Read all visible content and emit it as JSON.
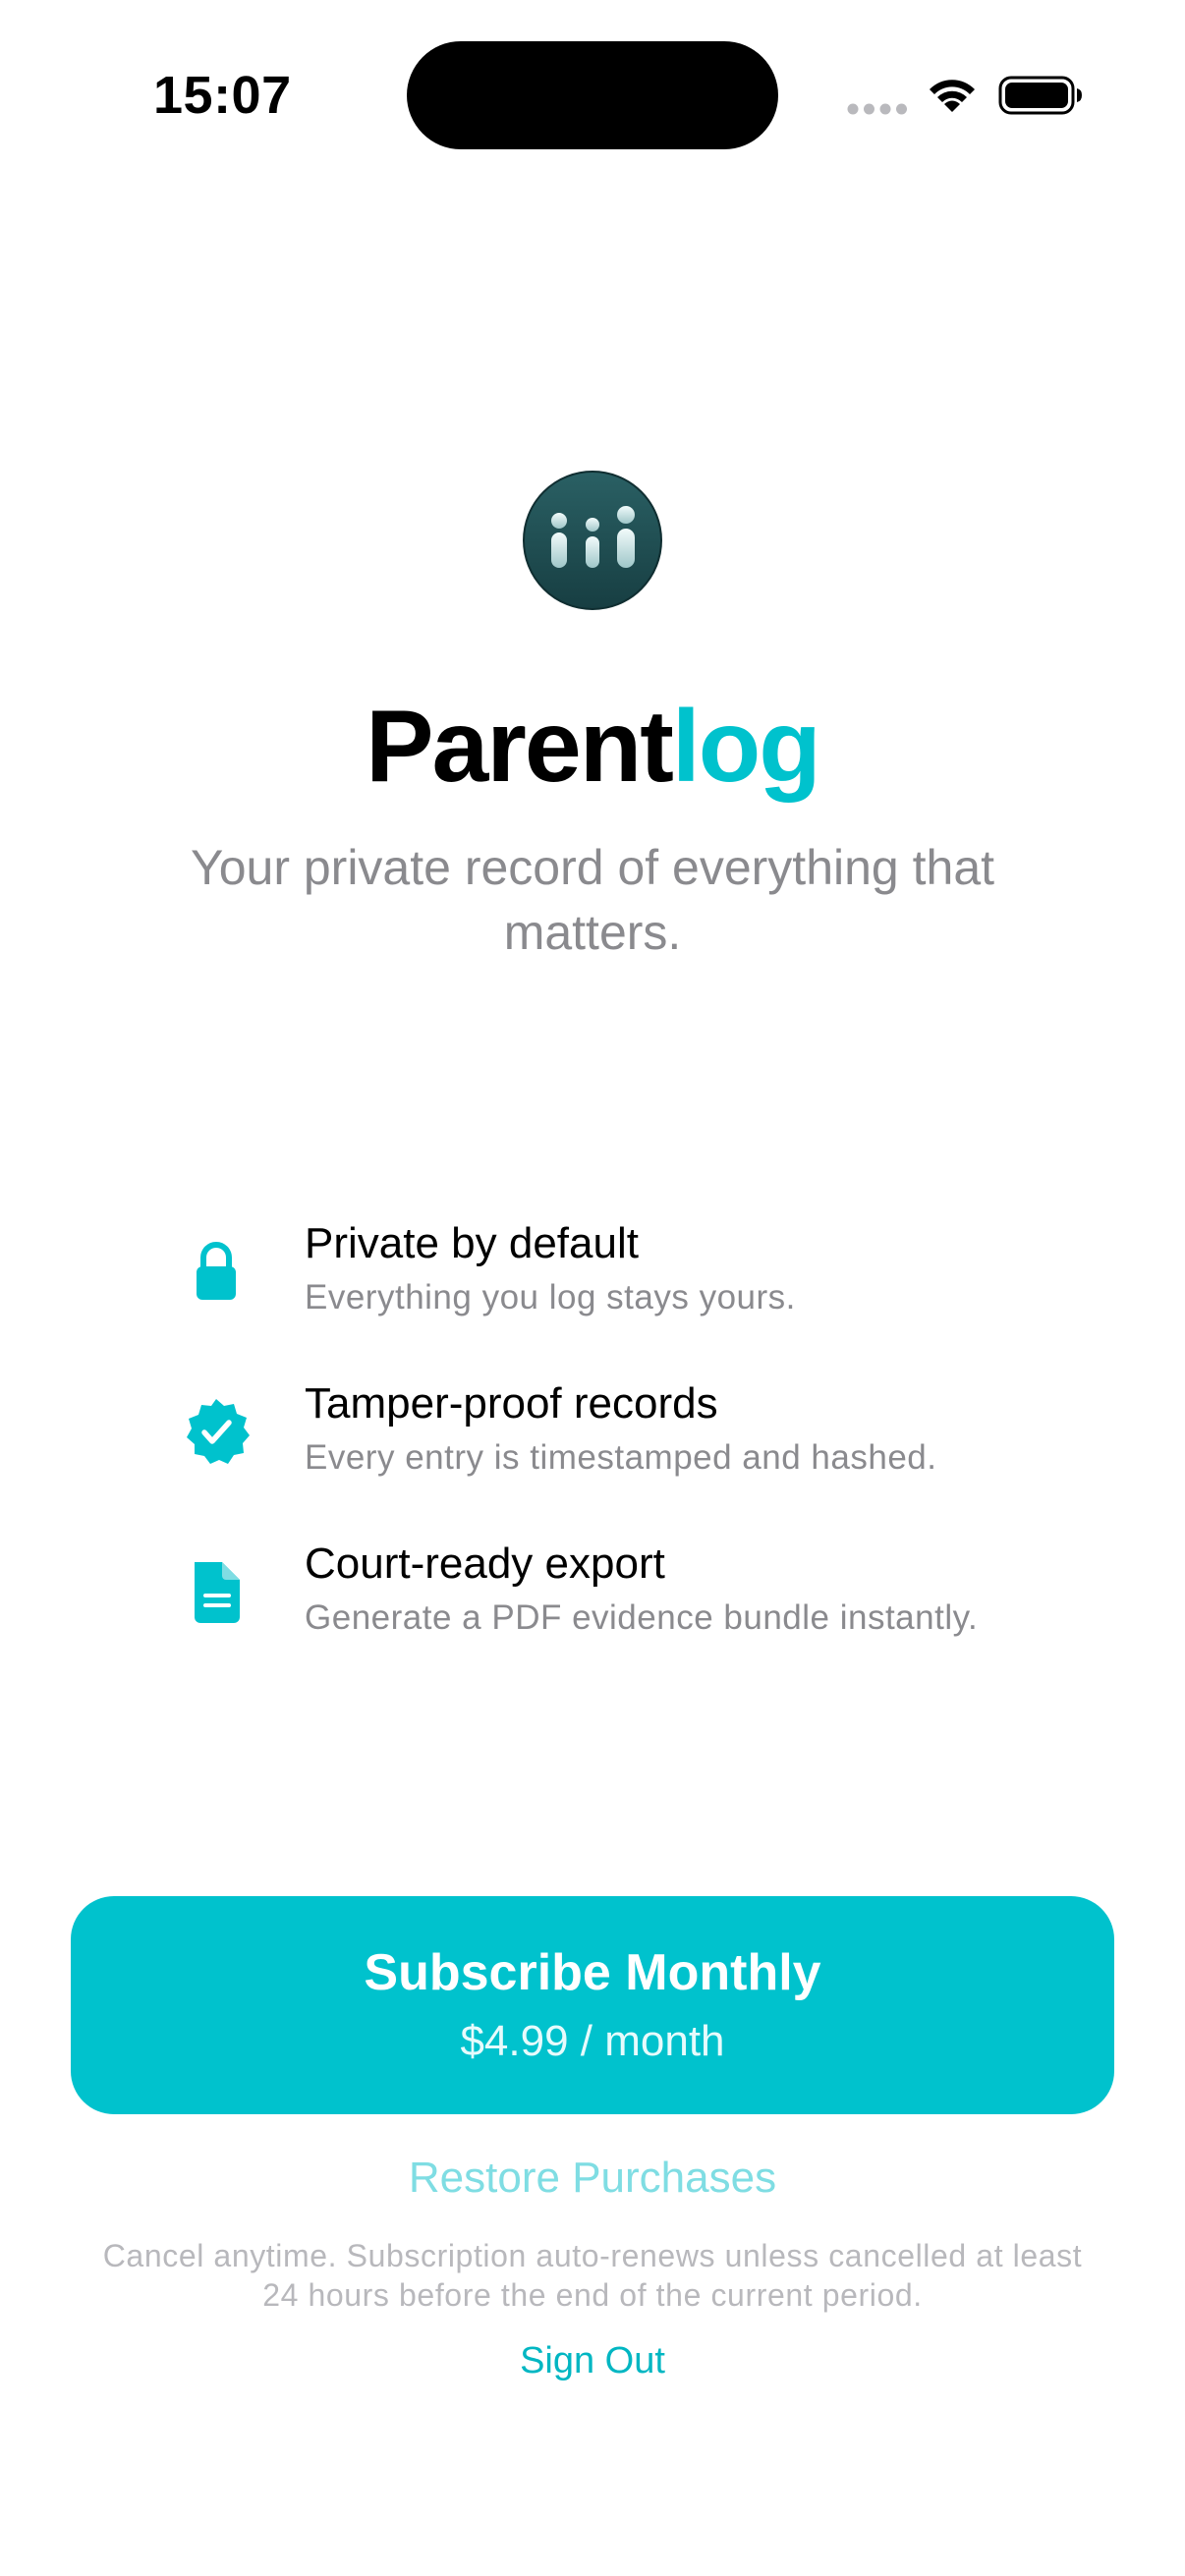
{
  "status_bar": {
    "time": "15:07"
  },
  "brand": {
    "name_part_1": "Parent",
    "name_part_2": "log",
    "tagline": "Your private record of everything that matters.",
    "logo_icon": "parentlog-logo-icon"
  },
  "features": [
    {
      "icon": "lock-icon",
      "title": "Private by default",
      "description": "Everything you log stays yours."
    },
    {
      "icon": "verified-badge-icon",
      "title": "Tamper-proof records",
      "description": "Every entry is timestamped and hashed."
    },
    {
      "icon": "document-icon",
      "title": "Court-ready export",
      "description": "Generate a PDF evidence bundle instantly."
    }
  ],
  "subscribe": {
    "title": "Subscribe Monthly",
    "price": "$4.99 / month"
  },
  "restore_label": "Restore Purchases",
  "disclaimer": "Cancel anytime. Subscription auto-renews unless cancelled at least 24 hours before the end of the current period.",
  "sign_out_label": "Sign Out",
  "colors": {
    "accent": "#00c2cd",
    "secondary_text": "#8a8a8e",
    "logo_bg": "#1f4e52"
  }
}
